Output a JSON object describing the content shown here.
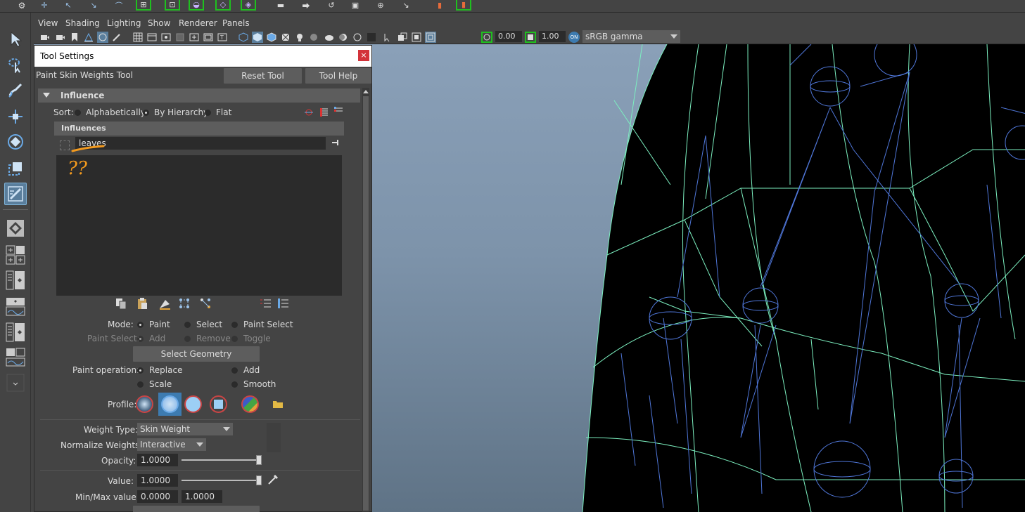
{
  "menu": {
    "view": "View",
    "shading": "Shading",
    "lighting": "Lighting",
    "show": "Show",
    "renderer": "Renderer",
    "panels": "Panels"
  },
  "viewport_toolbar": {
    "exposure": "0.00",
    "gamma": "1.00",
    "color_space": "sRGB gamma"
  },
  "panel": {
    "title": "Tool Settings",
    "close": "×",
    "tool_name": "Paint Skin Weights Tool",
    "reset_button": "Reset Tool",
    "help_button": "Tool Help"
  },
  "influence": {
    "header": "Influence",
    "sort_label": "Sort:",
    "sort_options": [
      "Alphabetically",
      "By Hierarchy",
      "Flat"
    ],
    "sort_selected": "By Hierarchy",
    "list_header": "Influences",
    "filter_value": "leaves",
    "annotation": "??"
  },
  "mode": {
    "label": "Mode:",
    "options": [
      "Paint",
      "Select",
      "Paint Select"
    ],
    "selected": "Paint",
    "paint_select_label": "Paint Select:",
    "paint_select_options": [
      "Add",
      "Remove",
      "Toggle"
    ],
    "select_geometry": "Select Geometry"
  },
  "paint_operation": {
    "label": "Paint operation:",
    "options": [
      "Replace",
      "Add",
      "Scale",
      "Smooth"
    ],
    "selected": "Replace"
  },
  "profile": {
    "label": "Profile:",
    "brushes": [
      "gaussian-brush-icon",
      "soft-brush-icon",
      "solid-circle-brush-icon",
      "square-brush-icon",
      "image-brush-icon",
      "folder-icon"
    ],
    "selected": "soft-brush-icon"
  },
  "weights": {
    "weight_type_label": "Weight Type:",
    "weight_type": "Skin Weight",
    "normalize_label": "Normalize Weights:",
    "normalize": "Interactive",
    "opacity_label": "Opacity:",
    "opacity": "1.0000",
    "opacity_level": 1.0,
    "value_label": "Value:",
    "value": "1.0000",
    "value_level": 1.0,
    "minmax_label": "Min/Max value:",
    "min": "0.0000",
    "max": "1.0000"
  },
  "colors": {
    "accent_green": "#1fbf1f",
    "wire_bone": "#4f76d8",
    "wire_mesh": "#7cf0c0",
    "selected_tool": "#5a7e9c",
    "close_red": "#d3333a"
  }
}
